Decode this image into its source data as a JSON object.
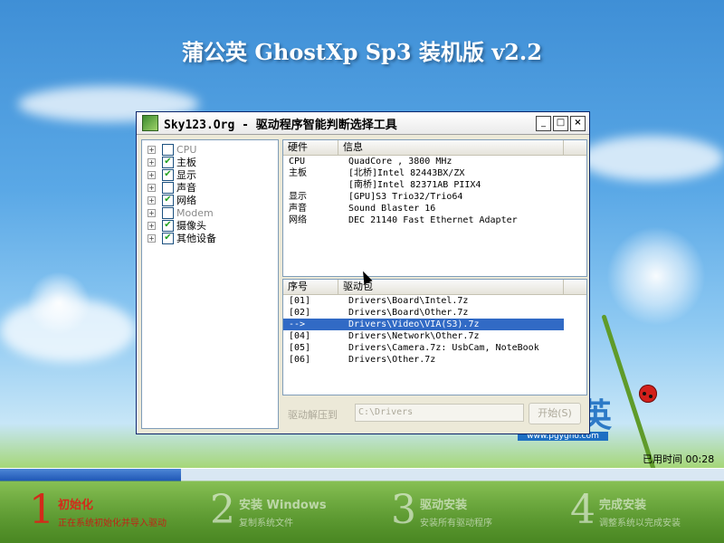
{
  "banner": {
    "title": "蒲公英 GhostXp Sp3 装机版 v2.2"
  },
  "watermark": {
    "logo_text": "英",
    "url": "www.pgygho.com"
  },
  "window": {
    "title": "Sky123.Org - 驱动程序智能判断选择工具",
    "min_label": "_",
    "max_label": "□",
    "close_label": "×"
  },
  "tree": {
    "items": [
      {
        "label": "CPU",
        "checked": false,
        "dim": true
      },
      {
        "label": "主板",
        "checked": true,
        "dim": false
      },
      {
        "label": "显示",
        "checked": true,
        "dim": false
      },
      {
        "label": "声音",
        "checked": false,
        "dim": false
      },
      {
        "label": "网络",
        "checked": true,
        "dim": false
      },
      {
        "label": "Modem",
        "checked": false,
        "dim": true
      },
      {
        "label": "摄像头",
        "checked": true,
        "dim": false
      },
      {
        "label": "其他设备",
        "checked": true,
        "dim": false
      }
    ]
  },
  "hardware": {
    "col1": "硬件",
    "col2": "信息",
    "rows": [
      {
        "hw": "CPU",
        "info": "QuadCore , 3800 MHz"
      },
      {
        "hw": "主板",
        "info": "[北桥]Intel 82443BX/ZX"
      },
      {
        "hw": "",
        "info": "[南桥]Intel 82371AB PIIX4"
      },
      {
        "hw": "显示",
        "info": "[GPU]S3 Trio32/Trio64"
      },
      {
        "hw": "声音",
        "info": "Sound Blaster 16"
      },
      {
        "hw": "网络",
        "info": "DEC 21140 Fast Ethernet Adapter"
      }
    ]
  },
  "drivers": {
    "col1": "序号",
    "col2": "驱动包",
    "rows": [
      {
        "no": "[01]",
        "pkg": "Drivers\\Board\\Intel.7z",
        "selected": false
      },
      {
        "no": "[02]",
        "pkg": "Drivers\\Board\\Other.7z",
        "selected": false
      },
      {
        "no": "-->",
        "pkg": "Drivers\\Video\\VIA(S3).7z",
        "selected": true
      },
      {
        "no": "[04]",
        "pkg": "Drivers\\Network\\Other.7z",
        "selected": false
      },
      {
        "no": "[05]",
        "pkg": "Drivers\\Camera.7z: UsbCam, NoteBook",
        "selected": false
      },
      {
        "no": "[06]",
        "pkg": "Drivers\\Other.7z",
        "selected": false
      }
    ]
  },
  "extract": {
    "label": "驱动解压到",
    "path": "C:\\Drivers",
    "start_label": "开始(S)"
  },
  "status": {
    "elapsed": "已用时间 00:28",
    "progress": 0.25
  },
  "steps": [
    {
      "num": "1",
      "title": "初始化",
      "sub": "正在系统初始化并导入驱动",
      "active": true
    },
    {
      "num": "2",
      "title": "安装 Windows",
      "sub": "复制系统文件",
      "active": false
    },
    {
      "num": "3",
      "title": "驱动安装",
      "sub": "安装所有驱动程序",
      "active": false
    },
    {
      "num": "4",
      "title": "完成安装",
      "sub": "调整系统以完成安装",
      "active": false
    }
  ],
  "colors": {
    "selection": "#316ac5",
    "active_step": "#d32a1a",
    "progress": "#1d55b4"
  }
}
